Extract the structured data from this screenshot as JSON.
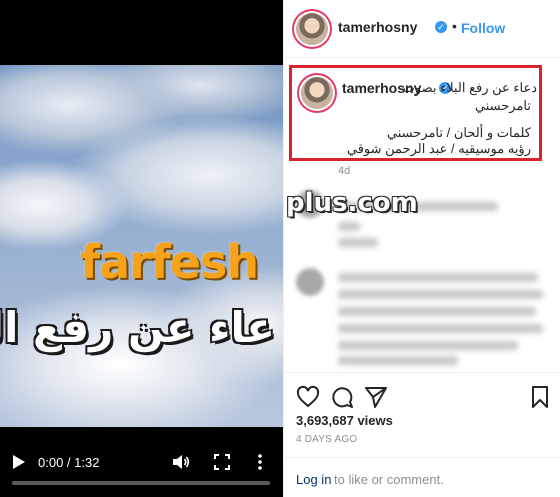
{
  "video": {
    "watermark": "farfesh",
    "arabic_overlay": "عاء عن رفع البـ",
    "time": "0:00 / 1:32",
    "progress": 0.0
  },
  "header": {
    "username": "tamerhosny",
    "dot": "•",
    "follow_label": "Follow"
  },
  "caption": {
    "username": "tamerhosny",
    "line1": "دعاء عن رفع البلاء بصوت",
    "line2": "تامرحسني",
    "line3": "كلمات و ألحان / تامرحسني",
    "line4": "رؤيه موسيقيه / عبد الرحمن شوقي",
    "age": "4d"
  },
  "watermark_right": "plus.com",
  "stats": {
    "views": "3,693,687 views",
    "date": "4 DAYS AGO"
  },
  "comment_bar": {
    "login": "Log in",
    "rest": "to like or comment."
  },
  "colors": {
    "accent": "#3897f0",
    "highlight_box": "#d9232a",
    "watermark_orange": "#f7a21b"
  }
}
